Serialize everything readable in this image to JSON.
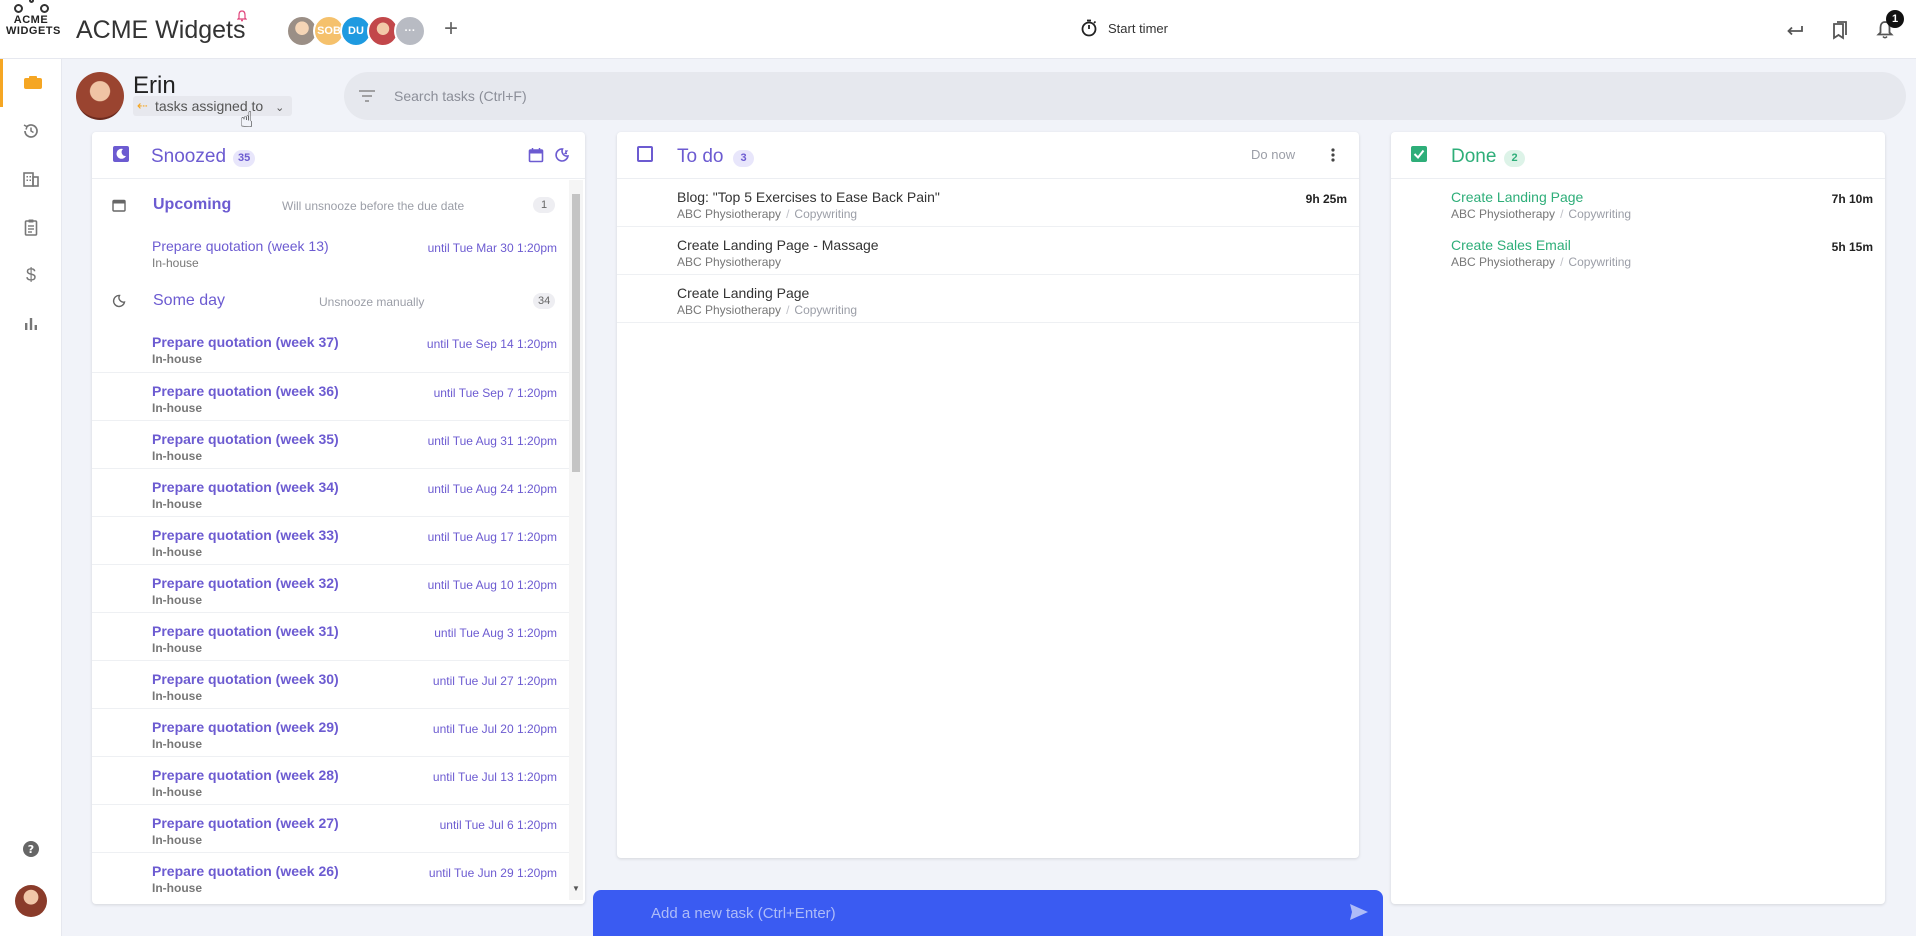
{
  "app": {
    "logo_text": "ACME WIDGETS",
    "title": "ACME Widgets",
    "members": [
      {
        "initials": "",
        "color": "#f2c9a0"
      },
      {
        "initials": "SOB",
        "color": "#f5c16c"
      },
      {
        "initials": "DU",
        "color": "#1e9ae0"
      },
      {
        "initials": "",
        "color": "#e7a0a0"
      },
      {
        "initials": "···",
        "color": "#b8bbc3"
      }
    ],
    "add_member": "+",
    "timer_label": "Start timer",
    "notification_count": "1"
  },
  "user": {
    "name": "Erin",
    "filter_label": "tasks assigned to"
  },
  "search": {
    "placeholder": "Search tasks (Ctrl+F)"
  },
  "snoozed": {
    "title": "Snoozed",
    "count": "35",
    "upcoming": {
      "title": "Upcoming",
      "subtitle": "Will unsnooze before the due date",
      "count": "1",
      "items": [
        {
          "name": "Prepare quotation (week 13)",
          "project": "In-house",
          "until": "until Tue Mar 30 1:20pm"
        }
      ]
    },
    "someday": {
      "title": "Some day",
      "subtitle": "Unsnooze manually",
      "count": "34",
      "items": [
        {
          "name": "Prepare quotation (week 37)",
          "project": "In-house",
          "until": "until Tue Sep 14 1:20pm"
        },
        {
          "name": "Prepare quotation (week 36)",
          "project": "In-house",
          "until": "until Tue Sep 7 1:20pm"
        },
        {
          "name": "Prepare quotation (week 35)",
          "project": "In-house",
          "until": "until Tue Aug 31 1:20pm"
        },
        {
          "name": "Prepare quotation (week 34)",
          "project": "In-house",
          "until": "until Tue Aug 24 1:20pm"
        },
        {
          "name": "Prepare quotation (week 33)",
          "project": "In-house",
          "until": "until Tue Aug 17 1:20pm"
        },
        {
          "name": "Prepare quotation (week 32)",
          "project": "In-house",
          "until": "until Tue Aug 10 1:20pm"
        },
        {
          "name": "Prepare quotation (week 31)",
          "project": "In-house",
          "until": "until Tue Aug 3 1:20pm"
        },
        {
          "name": "Prepare quotation (week 30)",
          "project": "In-house",
          "until": "until Tue Jul 27 1:20pm"
        },
        {
          "name": "Prepare quotation (week 29)",
          "project": "In-house",
          "until": "until Tue Jul 20 1:20pm"
        },
        {
          "name": "Prepare quotation (week 28)",
          "project": "In-house",
          "until": "until Tue Jul 13 1:20pm"
        },
        {
          "name": "Prepare quotation (week 27)",
          "project": "In-house",
          "until": "until Tue Jul 6 1:20pm"
        },
        {
          "name": "Prepare quotation (week 26)",
          "project": "In-house",
          "until": "until Tue Jun 29 1:20pm"
        }
      ]
    }
  },
  "todo": {
    "title": "To do",
    "count": "3",
    "do_now": "Do now",
    "tasks": [
      {
        "name": "Blog: \"Top 5 Exercises to Ease Back Pain\"",
        "project": "ABC Physiotherapy",
        "category": "Copywriting",
        "time": "9h 25m"
      },
      {
        "name": "Create Landing Page - Massage",
        "project": "ABC Physiotherapy",
        "category": "",
        "time": ""
      },
      {
        "name": "Create Landing Page",
        "project": "ABC Physiotherapy",
        "category": "Copywriting",
        "time": ""
      }
    ]
  },
  "done": {
    "title": "Done",
    "count": "2",
    "tasks": [
      {
        "name": "Create Landing Page",
        "project": "ABC Physiotherapy",
        "category": "Copywriting",
        "time": "7h 10m"
      },
      {
        "name": "Create Sales Email",
        "project": "ABC Physiotherapy",
        "category": "Copywriting",
        "time": "5h 15m"
      }
    ]
  },
  "add_task": {
    "placeholder": "Add a new task (Ctrl+Enter)"
  },
  "colors": {
    "accent_purple": "#6c5bd1",
    "accent_green": "#2eae79",
    "accent_blue": "#3a5bf2",
    "nav_active": "#f5a623"
  }
}
